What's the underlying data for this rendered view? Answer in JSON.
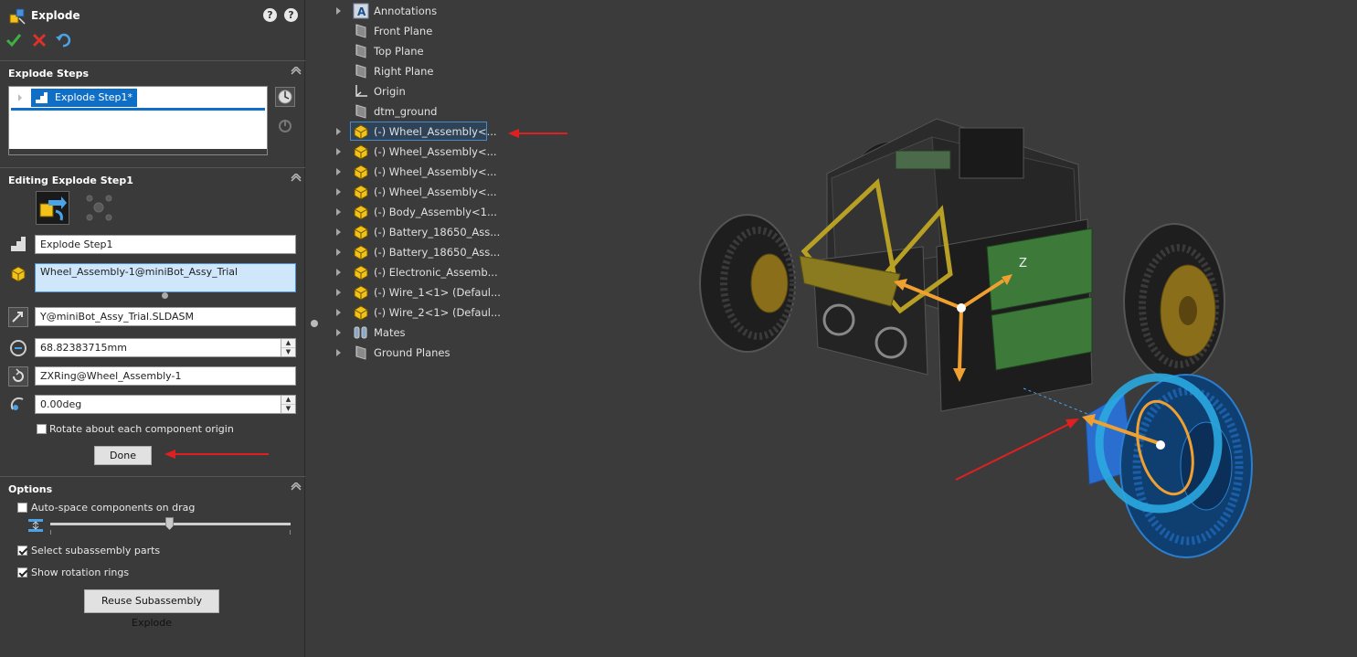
{
  "pm": {
    "title": "Explode",
    "help_icons": [
      "?",
      "?"
    ],
    "sections": {
      "explode_steps": {
        "title": "Explode Steps",
        "selected_step": "Explode Step1*"
      },
      "editing": {
        "title": "Editing Explode Step1",
        "step_name": "Explode Step1",
        "component": "Wheel_Assembly-1@miniBot_Assy_Trial",
        "direction": "Y@miniBot_Assy_Trial.SLDASM",
        "distance": "68.82383715mm",
        "rotation_axis": "ZXRing@Wheel_Assembly-1",
        "angle": "0.00deg",
        "rotate_origin_label": "Rotate about each component origin",
        "done_label": "Done"
      },
      "options": {
        "title": "Options",
        "auto_space_label": "Auto-space components on drag",
        "select_sub_label": "Select subassembly parts",
        "show_rings_label": "Show rotation rings",
        "reuse_label": "Reuse Subassembly Explode",
        "auto_space_checked": false,
        "select_sub_checked": true,
        "show_rings_checked": true
      }
    }
  },
  "tree": {
    "items": [
      {
        "label": "Annotations",
        "icon": "annotations-icon"
      },
      {
        "label": "Front Plane",
        "icon": "plane-icon"
      },
      {
        "label": "Top Plane",
        "icon": "plane-icon"
      },
      {
        "label": "Right Plane",
        "icon": "plane-icon"
      },
      {
        "label": "Origin",
        "icon": "origin-icon"
      },
      {
        "label": "dtm_ground",
        "icon": "plane-icon"
      },
      {
        "label": "(-) Wheel_Assembly<...",
        "icon": "assembly-icon"
      },
      {
        "label": "(-) Wheel_Assembly<...",
        "icon": "assembly-icon"
      },
      {
        "label": "(-) Wheel_Assembly<...",
        "icon": "assembly-icon"
      },
      {
        "label": "(-) Wheel_Assembly<...",
        "icon": "assembly-icon"
      },
      {
        "label": "(-) Body_Assembly<1...",
        "icon": "assembly-icon"
      },
      {
        "label": "(-) Battery_18650_Ass...",
        "icon": "assembly-icon"
      },
      {
        "label": "(-) Battery_18650_Ass...",
        "icon": "assembly-icon"
      },
      {
        "label": "(-) Electronic_Assemb...",
        "icon": "assembly-icon"
      },
      {
        "label": "(-) Wire_1<1> (Defaul...",
        "icon": "assembly-icon"
      },
      {
        "label": "(-) Wire_2<1> (Defaul...",
        "icon": "assembly-icon"
      },
      {
        "label": "Mates",
        "icon": "mates-icon"
      },
      {
        "label": "Ground Planes",
        "icon": "plane-icon"
      }
    ],
    "selected_index": 6
  },
  "viewport": {
    "triad_axis_label": "Z"
  },
  "colors": {
    "selection_blue": "#0f6fc6",
    "triad_orange": "#f0a030",
    "ring_cyan": "#2aa8e0",
    "annotation_red": "#e02020"
  }
}
